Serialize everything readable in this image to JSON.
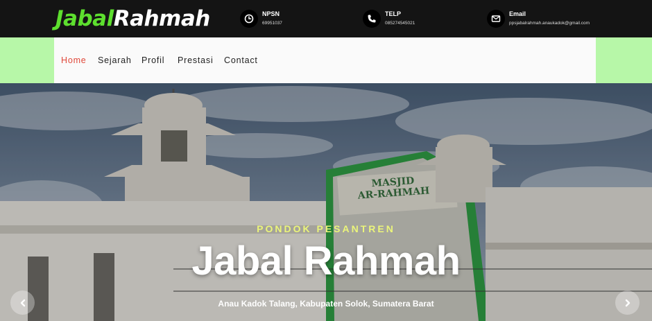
{
  "brand": {
    "logo_part1": "Jabal",
    "logo_part2": "Rahmah"
  },
  "contact": [
    {
      "icon": "clock-icon",
      "label": "NPSN",
      "value": "69951037"
    },
    {
      "icon": "phone-icon",
      "label": "TELP",
      "value": "085274545021"
    },
    {
      "icon": "envelope-icon",
      "label": "Email",
      "value": "ppsjabalrahmah.anaukadok@gmail.com"
    }
  ],
  "nav": {
    "items": [
      {
        "label": "Home",
        "active": true
      },
      {
        "label": "Sejarah"
      },
      {
        "label": "Profil"
      },
      {
        "label": "Prestasi"
      },
      {
        "label": "Contact"
      }
    ]
  },
  "hero": {
    "subtitle": "PONDOK PESANTREN",
    "title": "Jabal Rahmah",
    "address": "Anau Kadok Talang, Kabupaten Solok, Sumatera Barat",
    "sign_line1": "MASJID",
    "sign_line2": "AR-RAHMAH"
  },
  "colors": {
    "brand_green": "#5ddf2e",
    "nav_band": "#b7f7a8",
    "active_link": "#e0483a",
    "subtitle": "#ebf57a"
  }
}
